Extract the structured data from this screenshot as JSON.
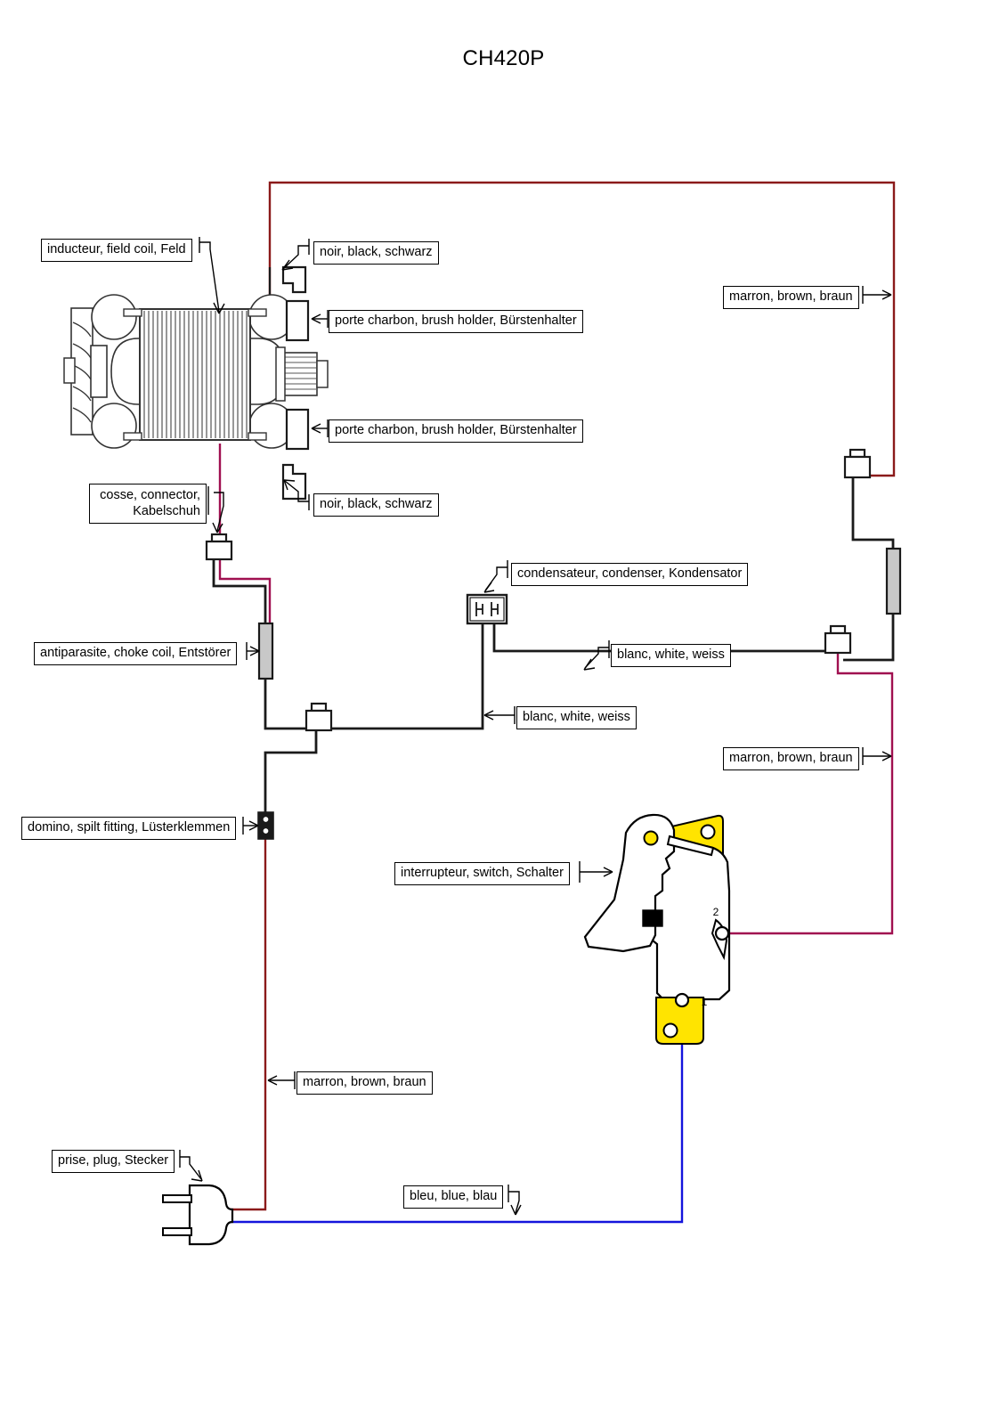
{
  "title": "CH420P",
  "labels": {
    "field_coil": "inducteur, field coil, Feld",
    "black_top": "noir, black, schwarz",
    "brush_holder_top": "porte charbon, brush holder, Bürstenhalter",
    "brush_holder_bottom": "porte charbon, brush holder, Bürstenhalter",
    "black_bottom": "noir, black, schwarz",
    "connector": "cosse, connector,\nKabelschuh",
    "connector_line1": "cosse, connector,",
    "connector_line2": "Kabelschuh",
    "choke_coil": "antiparasite, choke coil, Entstörer",
    "condenser": "condensateur, condenser, Kondensator",
    "white_right": "blanc, white, weiss",
    "white_mid": "blanc, white, weiss",
    "brown_topright": "marron, brown, braun",
    "brown_midright": "marron, brown, braun",
    "brown_bottomleft": "marron, brown, braun",
    "domino": "domino, spilt fitting, Lüsterklemmen",
    "switch": "interrupteur, switch, Schalter",
    "plug": "prise, plug, Stecker",
    "blue": "bleu, blue, blau"
  },
  "switch_terminals": {
    "terminal_1": "1",
    "terminal_2": "2"
  },
  "colors": {
    "wire_black": "#1a1a1a",
    "wire_brown": "#8b1a1a",
    "wire_magenta": "#a01050",
    "wire_blue": "#1414dc",
    "switch_yellow": "#ffe400",
    "choke_fill": "#c8c8c8",
    "outline": "#1a1a1a",
    "background": "#ffffff"
  }
}
